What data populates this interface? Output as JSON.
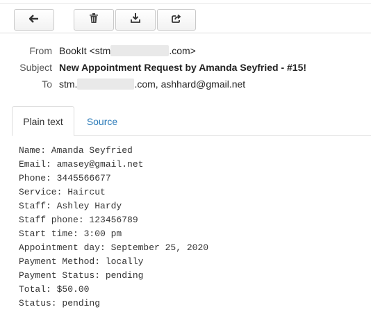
{
  "toolbar": {
    "buttons": [
      {
        "icon": "back-arrow-icon",
        "label": "Back"
      },
      {
        "icon": "trash-icon",
        "label": "Delete"
      },
      {
        "icon": "download-icon",
        "label": "Download"
      },
      {
        "icon": "forward-share-icon",
        "label": "Forward"
      }
    ]
  },
  "headers": {
    "from_label": "From",
    "from_value_prefix": "BookIt <stm",
    "from_value_suffix": ".com>",
    "subject_label": "Subject",
    "subject_value": "New Appointment Request by Amanda Seyfried - #15!",
    "to_label": "To",
    "to_value_prefix": "stm.",
    "to_value_suffix": ".com, ashhard@gmail.net"
  },
  "tabs": {
    "plain_text": "Plain text",
    "source": "Source"
  },
  "body": {
    "lines": [
      "Name: Amanda Seyfried",
      "Email: amasey@gmail.net",
      "Phone: 3445566677",
      "Service: Haircut",
      "Staff: Ashley Hardy",
      "Staff phone: 123456789",
      "Start time: 3:00 pm",
      "Appointment day: September 25, 2020",
      "Payment Method: locally",
      "Payment Status: pending",
      "Total: $50.00",
      "Status: pending"
    ]
  },
  "colors": {
    "link": "#2a7ab8",
    "border": "#dcdcdc"
  }
}
